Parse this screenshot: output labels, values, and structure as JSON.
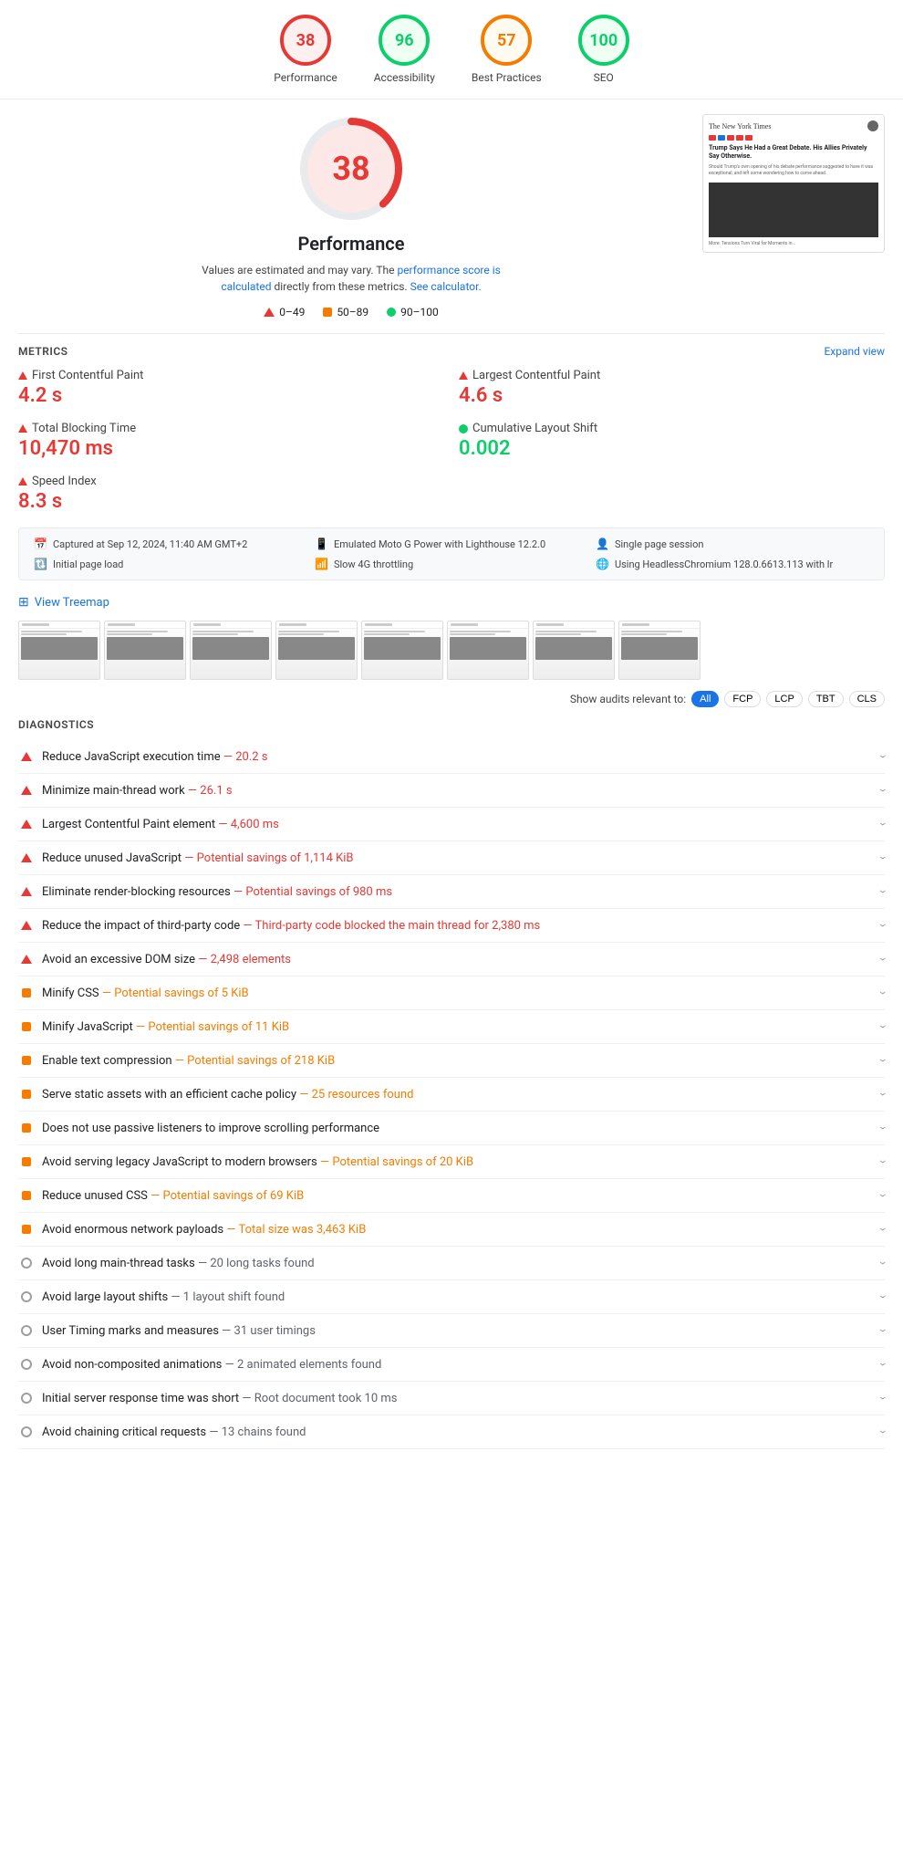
{
  "scores": [
    {
      "label": "Performance",
      "value": 38,
      "color": "red"
    },
    {
      "label": "Accessibility",
      "value": 96,
      "color": "green"
    },
    {
      "label": "Best Practices",
      "value": 57,
      "color": "orange"
    },
    {
      "label": "SEO",
      "value": 100,
      "color": "green"
    }
  ],
  "performance": {
    "title": "Performance",
    "score": 38,
    "desc_static": "Values are estimated and may vary. The ",
    "desc_link1": "performance score is calculated",
    "desc_mid": " directly from these metrics. ",
    "desc_link2": "See calculator.",
    "legend": [
      {
        "type": "triangle",
        "label": "0–49"
      },
      {
        "type": "square",
        "label": "50–89"
      },
      {
        "type": "circle",
        "label": "90–100"
      }
    ]
  },
  "metrics": {
    "section_title": "METRICS",
    "expand_label": "Expand view",
    "items": [
      {
        "name": "First Contentful Paint",
        "value": "4.2 s",
        "color": "red",
        "icon": "triangle"
      },
      {
        "name": "Largest Contentful Paint",
        "value": "4.6 s",
        "color": "red",
        "icon": "triangle"
      },
      {
        "name": "Total Blocking Time",
        "value": "10,470 ms",
        "color": "red",
        "icon": "triangle"
      },
      {
        "name": "Cumulative Layout Shift",
        "value": "0.002",
        "color": "green",
        "icon": "circle"
      },
      {
        "name": "Speed Index",
        "value": "8.3 s",
        "color": "red",
        "icon": "triangle"
      }
    ]
  },
  "infobar": {
    "items": [
      {
        "icon": "📅",
        "text": "Captured at Sep 12, 2024, 11:40 AM GMT+2"
      },
      {
        "icon": "📱",
        "text": "Emulated Moto G Power with Lighthouse 12.2.0"
      },
      {
        "icon": "👤",
        "text": "Single page session"
      },
      {
        "icon": "🔃",
        "text": "Initial page load"
      },
      {
        "icon": "📶",
        "text": "Slow 4G throttling"
      },
      {
        "icon": "🌐",
        "text": "Using HeadlessChromium 128.0.6613.113 with lr"
      }
    ]
  },
  "treemap": {
    "label": "View Treemap"
  },
  "audit_filters": {
    "label": "Show audits relevant to:",
    "buttons": [
      "All",
      "FCP",
      "LCP",
      "TBT",
      "CLS"
    ]
  },
  "diagnostics": {
    "section_title": "DIAGNOSTICS",
    "items": [
      {
        "icon": "triangle",
        "label": "Reduce JavaScript execution time",
        "detail": " — 20.2 s",
        "detail_color": "red"
      },
      {
        "icon": "triangle",
        "label": "Minimize main-thread work",
        "detail": " — 26.1 s",
        "detail_color": "red"
      },
      {
        "icon": "triangle",
        "label": "Largest Contentful Paint element",
        "detail": " — 4,600 ms",
        "detail_color": "red"
      },
      {
        "icon": "triangle",
        "label": "Reduce unused JavaScript",
        "detail": " — Potential savings of 1,114 KiB",
        "detail_color": "red"
      },
      {
        "icon": "triangle",
        "label": "Eliminate render-blocking resources",
        "detail": " — Potential savings of 980 ms",
        "detail_color": "red"
      },
      {
        "icon": "triangle",
        "label": "Reduce the impact of third-party code",
        "detail": " — Third-party code blocked the main thread for 2,380 ms",
        "detail_color": "red"
      },
      {
        "icon": "triangle",
        "label": "Avoid an excessive DOM size",
        "detail": " — 2,498 elements",
        "detail_color": "red"
      },
      {
        "icon": "square",
        "label": "Minify CSS",
        "detail": " — Potential savings of 5 KiB",
        "detail_color": "orange"
      },
      {
        "icon": "square",
        "label": "Minify JavaScript",
        "detail": " — Potential savings of 11 KiB",
        "detail_color": "orange"
      },
      {
        "icon": "square",
        "label": "Enable text compression",
        "detail": " — Potential savings of 218 KiB",
        "detail_color": "orange"
      },
      {
        "icon": "square",
        "label": "Serve static assets with an efficient cache policy",
        "detail": " — 25 resources found",
        "detail_color": "orange"
      },
      {
        "icon": "square",
        "label": "Does not use passive listeners to improve scrolling performance",
        "detail": "",
        "detail_color": "gray"
      },
      {
        "icon": "square",
        "label": "Avoid serving legacy JavaScript to modern browsers",
        "detail": " — Potential savings of 20 KiB",
        "detail_color": "orange"
      },
      {
        "icon": "square",
        "label": "Reduce unused CSS",
        "detail": " — Potential savings of 69 KiB",
        "detail_color": "orange"
      },
      {
        "icon": "square",
        "label": "Avoid enormous network payloads",
        "detail": " — Total size was 3,463 KiB",
        "detail_color": "orange"
      },
      {
        "icon": "circle",
        "label": "Avoid long main-thread tasks",
        "detail": " — 20 long tasks found",
        "detail_color": "gray"
      },
      {
        "icon": "circle",
        "label": "Avoid large layout shifts",
        "detail": " — 1 layout shift found",
        "detail_color": "gray"
      },
      {
        "icon": "circle",
        "label": "User Timing marks and measures",
        "detail": " — 31 user timings",
        "detail_color": "gray"
      },
      {
        "icon": "circle",
        "label": "Avoid non-composited animations",
        "detail": " — 2 animated elements found",
        "detail_color": "gray"
      },
      {
        "icon": "circle",
        "label": "Initial server response time was short",
        "detail": " — Root document took 10 ms",
        "detail_color": "gray"
      },
      {
        "icon": "circle",
        "label": "Avoid chaining critical requests",
        "detail": " — 13 chains found",
        "detail_color": "gray"
      }
    ]
  }
}
